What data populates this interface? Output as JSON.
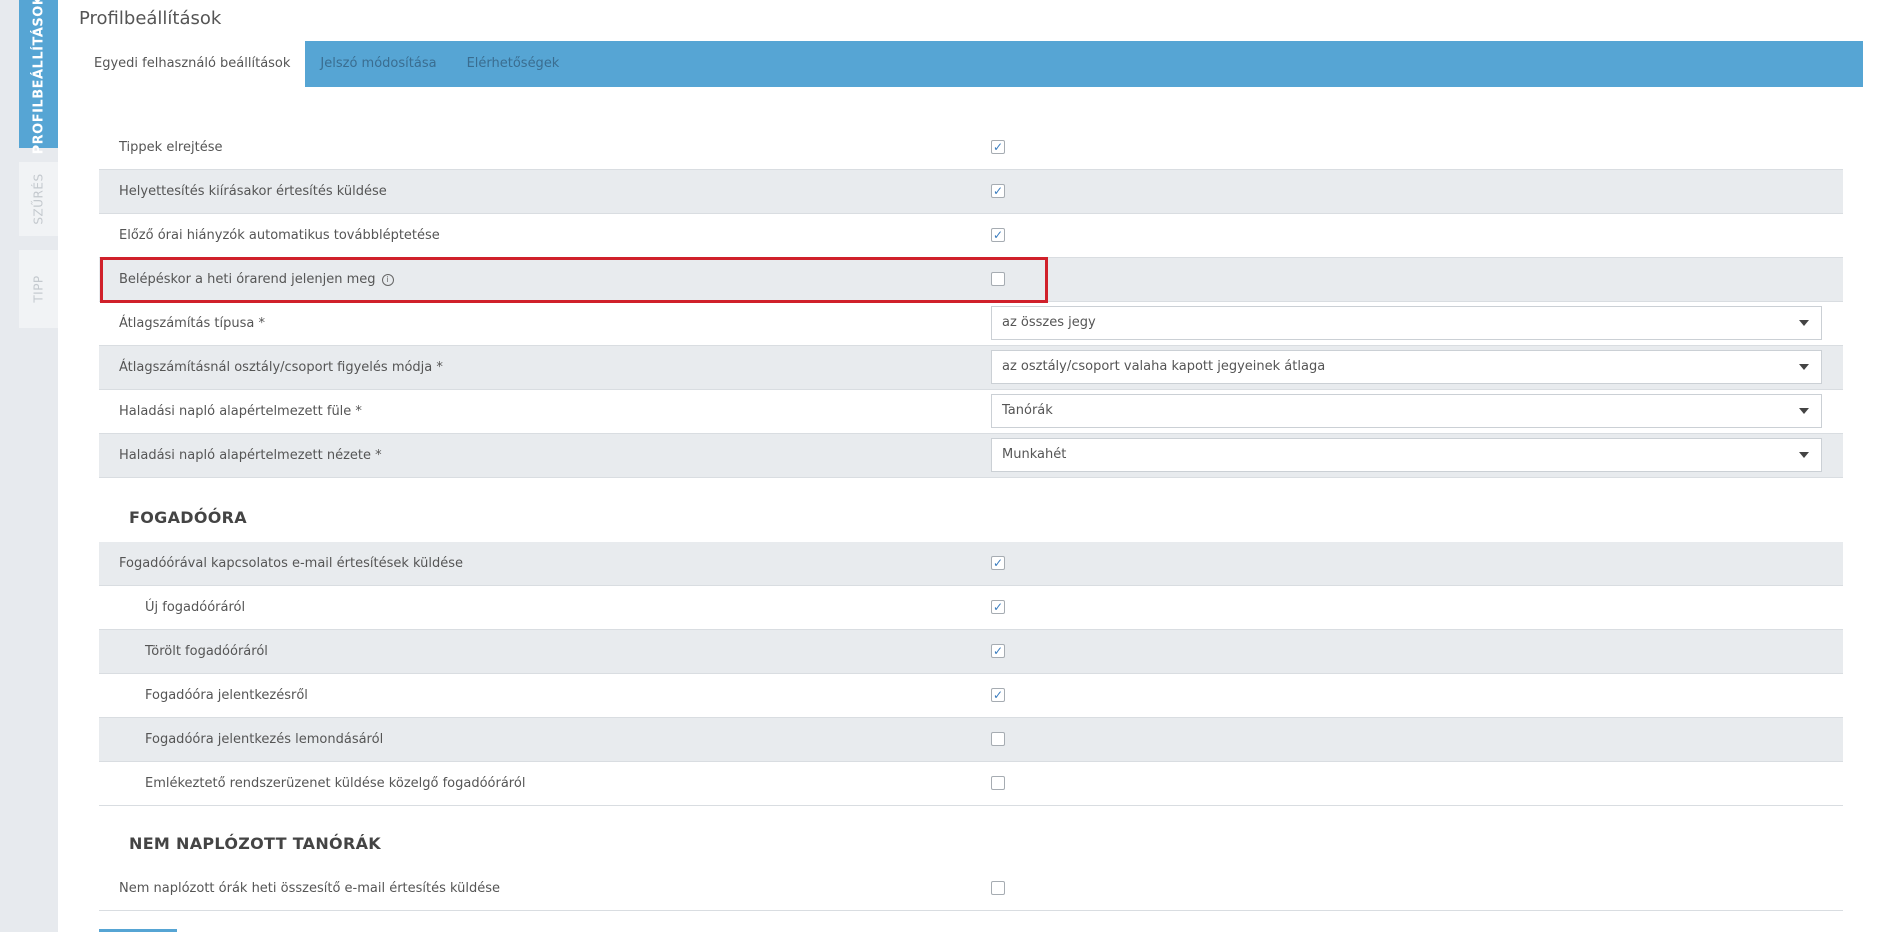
{
  "sidebar": {
    "tabs": [
      {
        "label": "PROFILBEÁLLÍTÁSOK"
      },
      {
        "label": "SZŰRÉS"
      },
      {
        "label": "TIPP"
      }
    ]
  },
  "page": {
    "title": "Profilbeállítások"
  },
  "tabs": [
    {
      "label": "Egyedi felhasználó beállítások"
    },
    {
      "label": "Jelszó módosítása"
    },
    {
      "label": "Elérhetőségek"
    }
  ],
  "settings": {
    "rows": [
      {
        "label": "Tippek elrejtése",
        "checked": true
      },
      {
        "label": "Helyettesítés kiírásakor értesítés küldése",
        "checked": true
      },
      {
        "label": "Előző órai hiányzók automatikus továbbléptetése",
        "checked": true
      },
      {
        "label": "Belépéskor a heti órarend jelenjen meg",
        "checked": false
      },
      {
        "label": "Átlagszámítás típusa *",
        "value": "az összes jegy"
      },
      {
        "label": "Átlagszámításnál osztály/csoport figyelés módja *",
        "value": "az osztály/csoport valaha kapott jegyeinek átlaga"
      },
      {
        "label": "Haladási napló alapértelmezett füle *",
        "value": "Tanórák"
      },
      {
        "label": "Haladási napló alapértelmezett nézete *",
        "value": "Munkahét"
      }
    ]
  },
  "fogadoora": {
    "title": "FOGADÓÓRA",
    "rows": [
      {
        "label": "Fogadóórával kapcsolatos e-mail értesítések küldése",
        "checked": true
      },
      {
        "label": "Új fogadóóráról",
        "checked": true
      },
      {
        "label": "Törölt fogadóóráról",
        "checked": true
      },
      {
        "label": "Fogadóóra jelentkezésről",
        "checked": true
      },
      {
        "label": "Fogadóóra jelentkezés lemondásáról",
        "checked": false
      },
      {
        "label": "Emlékeztető rendszerüzenet küldése közelgő fogadóóráról",
        "checked": false
      }
    ]
  },
  "nem_naplozott": {
    "title": "NEM NAPLÓZOTT TANÓRÁK",
    "rows": [
      {
        "label": "Nem naplózott órák heti összesítő e-mail értesítés küldése",
        "checked": false
      }
    ]
  },
  "colors": {
    "accent": "#56a5d4",
    "highlight": "#d0202a",
    "row_alt": "#e8ebee"
  }
}
